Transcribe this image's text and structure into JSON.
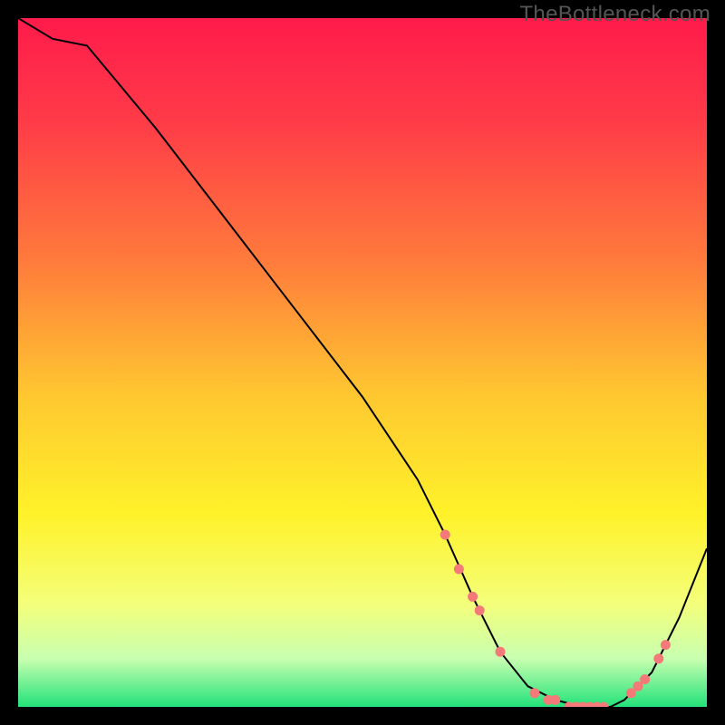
{
  "watermark": "TheBottleneck.com",
  "chart_data": {
    "type": "line",
    "title": "",
    "xlabel": "",
    "ylabel": "",
    "xlim": [
      0,
      100
    ],
    "ylim": [
      0,
      100
    ],
    "grid": false,
    "background_gradient": {
      "stops": [
        {
          "offset": 0,
          "color": "#ff1b4b"
        },
        {
          "offset": 0.15,
          "color": "#ff3b48"
        },
        {
          "offset": 0.35,
          "color": "#ff7a3c"
        },
        {
          "offset": 0.55,
          "color": "#ffc830"
        },
        {
          "offset": 0.72,
          "color": "#fff22a"
        },
        {
          "offset": 0.85,
          "color": "#f4ff7a"
        },
        {
          "offset": 0.93,
          "color": "#c8ffb0"
        },
        {
          "offset": 1.0,
          "color": "#23e27a"
        }
      ]
    },
    "series": [
      {
        "name": "curve",
        "color": "#000000",
        "stroke_width": 2,
        "x": [
          0,
          5,
          10,
          20,
          30,
          40,
          50,
          58,
          62,
          66,
          70,
          74,
          78,
          82,
          86,
          88,
          92,
          96,
          100
        ],
        "y": [
          100,
          97,
          96,
          84,
          71,
          58,
          45,
          33,
          25,
          16,
          8,
          3,
          1,
          0,
          0,
          1,
          5,
          13,
          23
        ]
      }
    ],
    "markers": {
      "name": "dots",
      "color": "#f47a7a",
      "radius": 5.5,
      "points": [
        {
          "x": 62,
          "y": 25
        },
        {
          "x": 64,
          "y": 20
        },
        {
          "x": 66,
          "y": 16
        },
        {
          "x": 67,
          "y": 14
        },
        {
          "x": 70,
          "y": 8
        },
        {
          "x": 75,
          "y": 2
        },
        {
          "x": 77,
          "y": 1
        },
        {
          "x": 78,
          "y": 1
        },
        {
          "x": 80,
          "y": 0
        },
        {
          "x": 81,
          "y": 0
        },
        {
          "x": 82,
          "y": 0
        },
        {
          "x": 83,
          "y": 0
        },
        {
          "x": 84,
          "y": 0
        },
        {
          "x": 85,
          "y": 0
        },
        {
          "x": 89,
          "y": 2
        },
        {
          "x": 90,
          "y": 3
        },
        {
          "x": 91,
          "y": 4
        },
        {
          "x": 93,
          "y": 7
        },
        {
          "x": 94,
          "y": 9
        }
      ]
    }
  }
}
